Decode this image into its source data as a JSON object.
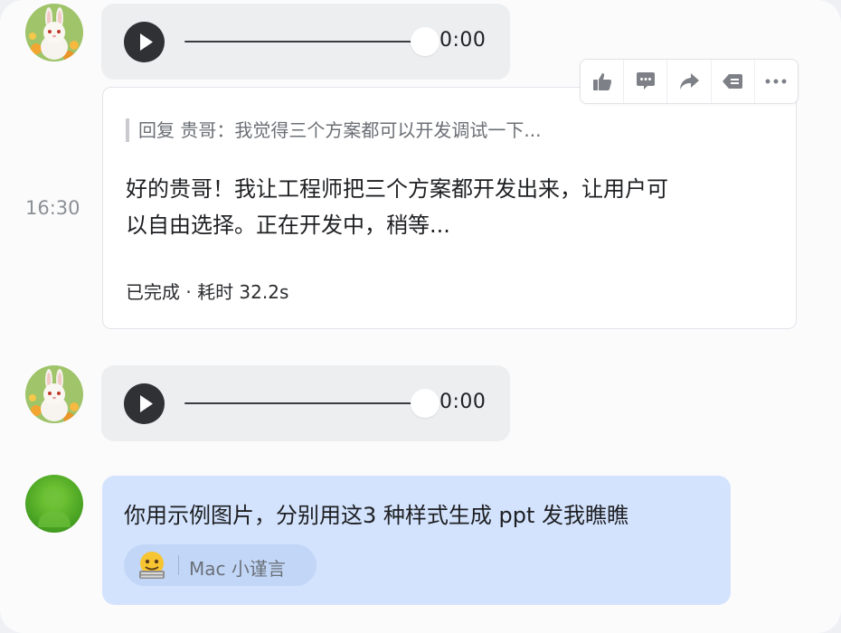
{
  "audio_messages": [
    {
      "time": "0:00"
    },
    {
      "time": "0:00"
    }
  ],
  "timestamp": "16:30",
  "reply_card": {
    "quote": "回复 贵哥：我觉得三个方案都可以开发调试一下...",
    "body_line1": "好的贵哥！我让工程师把三个方案都开发出来，让用户可",
    "body_line2": "以自由选择。正在开发中，稍等...",
    "status": "已完成 · 耗时 32.2s"
  },
  "toolbar": {
    "icons": [
      "thumbs-up-icon",
      "comment-icon",
      "forward-icon",
      "backspace-icon",
      "more-icon"
    ]
  },
  "user_message": {
    "text": "你用示例图片，分别用这3 种样式生成 ppt 发我瞧瞧",
    "chip_label": "Mac 小谨言"
  },
  "colors": {
    "bubble_bg": "#d3e3fd",
    "audio_bg": "#eceef0",
    "play_button": "#2f3135"
  }
}
